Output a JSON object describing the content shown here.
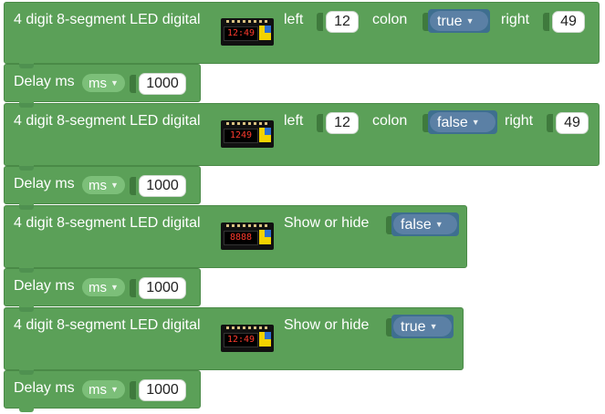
{
  "led_block_label": "4 digit 8-segment LED digital",
  "led_image_alt": "4 digit 8-segment LED module",
  "left_label": "left",
  "colon_label": "colon",
  "right_label": "right",
  "show_hide_label": "Show or hide",
  "delay_label": "Delay ms",
  "delay_unit": "ms",
  "colors": {
    "block_green": "#5ba058",
    "dropdown_blue": "#5b80a5",
    "led_red": "#ff3b2e"
  },
  "blocks": [
    {
      "type": "led_display",
      "left_value": "12",
      "colon_value": "true",
      "right_value": "49",
      "display_text": "12:49"
    },
    {
      "type": "delay",
      "value": "1000"
    },
    {
      "type": "led_display",
      "left_value": "12",
      "colon_value": "false",
      "right_value": "49",
      "display_text": "1249"
    },
    {
      "type": "delay",
      "value": "1000"
    },
    {
      "type": "led_show_hide",
      "show_value": "false",
      "display_text": "8888"
    },
    {
      "type": "delay",
      "value": "1000"
    },
    {
      "type": "led_show_hide",
      "show_value": "true",
      "display_text": "12:49"
    },
    {
      "type": "delay",
      "value": "1000"
    }
  ]
}
